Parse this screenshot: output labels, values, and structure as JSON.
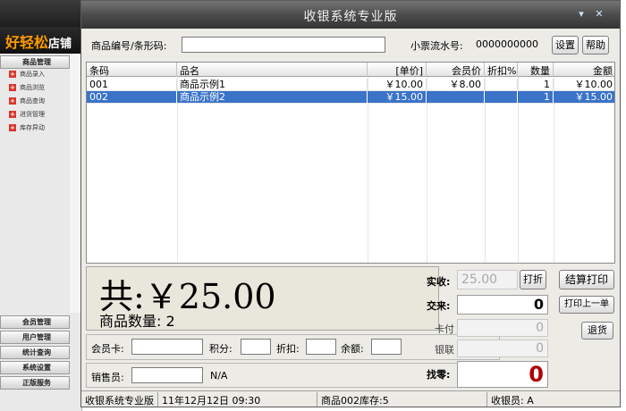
{
  "background_app": {
    "logo": "好轻松",
    "logo_sub": "店铺",
    "top_section": "商品管理",
    "menu_items": [
      "商品录入",
      "商品浏览",
      "商品查询",
      "进货管理",
      "库存异动"
    ],
    "bottom_sections": [
      "会员管理",
      "用户管理",
      "统计查询",
      "系统设置",
      "正版服务"
    ]
  },
  "window": {
    "title": "收银系统专业版",
    "min_glyph": "▾",
    "close_glyph": "✕"
  },
  "toolbar": {
    "barcode_label": "商品编号/条形码:",
    "barcode_value": "",
    "ticket_label": "小票流水号:",
    "ticket_no": "0000000000",
    "settings_label": "设置",
    "help_label": "帮助"
  },
  "grid": {
    "columns": [
      "条码",
      "品名",
      "[单价]",
      "会员价",
      "折扣%",
      "数量",
      "金额"
    ],
    "rows": [
      {
        "code": "001",
        "name": "商品示例1",
        "price": "￥10.00",
        "member_price": "￥8.00",
        "discount": "",
        "qty": "1",
        "amount": "￥10.00",
        "selected": false
      },
      {
        "code": "002",
        "name": "商品示例2",
        "price": "￥15.00",
        "member_price": "",
        "discount": "",
        "qty": "1",
        "amount": "￥15.00",
        "selected": true
      }
    ]
  },
  "totals": {
    "total_text": "共:￥25.00",
    "qty_text": "商品数量: 2"
  },
  "member": {
    "card_label": "会员卡:",
    "points_label": "积分:",
    "discount_label": "折扣:",
    "balance_label": "余额:"
  },
  "seller": {
    "label": "销售员:",
    "value": "N/A"
  },
  "payment": {
    "received_label": "实收:",
    "received_value": "25.00",
    "print_discount_label": "打折",
    "tender_label": "交来:",
    "tender_value": "0",
    "card_label": "卡付",
    "card_value": "0",
    "unionpay_label": "银联",
    "unionpay_value": "0",
    "change_label": "找零:",
    "change_value": "0",
    "change_color": "#b00000"
  },
  "actions": {
    "checkout_print": "结算打印",
    "print_last": "打印上一单",
    "refund": "退货"
  },
  "statusbar": {
    "app": "收银系统专业版",
    "date": "11年12月12日  09:30",
    "stock": "商品002库存:5",
    "cashier": "收银员: A"
  }
}
